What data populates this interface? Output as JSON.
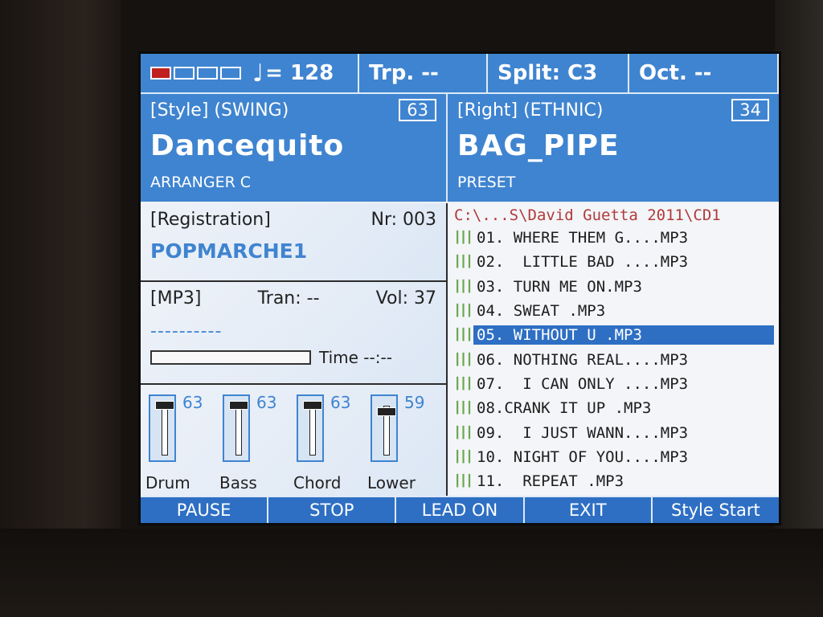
{
  "topbar": {
    "tempo": "= 128",
    "trp": "Trp. --",
    "split": "Split: C3",
    "oct": "Oct. --"
  },
  "style": {
    "header_left": "[Style]  (SWING)",
    "number": "63",
    "name": "Dancequito",
    "sub": "ARRANGER C"
  },
  "voice": {
    "header_left": "[Right]  (ETHNIC)",
    "number": "34",
    "name": "BAG_PIPE",
    "sub": "PRESET"
  },
  "registration": {
    "label": "[Registration]",
    "nr": "Nr: 003",
    "name": "POPMARCHE1"
  },
  "mp3": {
    "label": "[MP3]",
    "tran": "Tran: --",
    "vol": "Vol: 37",
    "dash": "----------",
    "time": "Time --:--"
  },
  "mixer": [
    {
      "label": "Drum",
      "value": "63"
    },
    {
      "label": "Bass",
      "value": "63"
    },
    {
      "label": "Chord",
      "value": "63"
    },
    {
      "label": "Lower",
      "value": "59"
    }
  ],
  "playlist": {
    "path": "C:\\...S\\David Guetta  2011\\CD1",
    "items": [
      "01. WHERE THEM G....MP3",
      "02.  LITTLE BAD ....MP3",
      "03. TURN ME ON.MP3",
      "04. SWEAT .MP3",
      "05. WITHOUT U .MP3",
      "06. NOTHING REAL....MP3",
      "07.  I CAN ONLY ....MP3",
      "08.CRANK IT UP .MP3",
      "09.  I JUST WANN....MP3",
      "10. NIGHT OF YOU....MP3",
      "11.  REPEAT .MP3"
    ],
    "selected_index": 4
  },
  "softkeys": [
    "PAUSE",
    "STOP",
    "LEAD ON",
    "EXIT",
    "Style Start"
  ],
  "colors": {
    "accent": "#3f84d0",
    "selection": "#2e6fc4",
    "path": "#b23a3a",
    "meter_on": "#c0201e"
  },
  "icons": {
    "tempo": "quarter-note-icon",
    "track": "equalizer-icon"
  }
}
